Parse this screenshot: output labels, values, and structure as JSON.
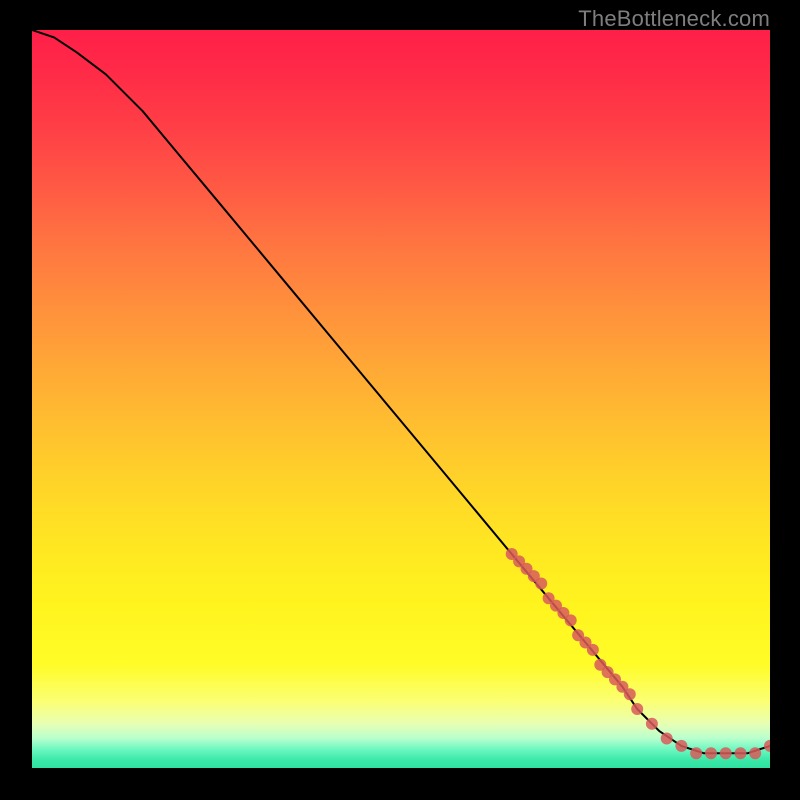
{
  "watermark": {
    "text": "TheBottleneck.com"
  },
  "chart_data": {
    "type": "line",
    "title": "",
    "xlabel": "",
    "ylabel": "",
    "xlim": [
      0,
      100
    ],
    "ylim": [
      0,
      100
    ],
    "grid": false,
    "legend": false,
    "series": [
      {
        "name": "bottleneck-curve",
        "color": "#000000",
        "x": [
          0,
          3,
          6,
          10,
          15,
          20,
          25,
          30,
          35,
          40,
          45,
          50,
          55,
          60,
          65,
          70,
          75,
          80,
          82,
          85,
          88,
          91,
          94,
          97,
          100
        ],
        "values": [
          100,
          99,
          97,
          94,
          89,
          83,
          77,
          71,
          65,
          59,
          53,
          47,
          41,
          35,
          29,
          23,
          17,
          11,
          8,
          5,
          3,
          2,
          2,
          2,
          3
        ]
      }
    ],
    "data_points": {
      "name": "observed-points",
      "color": "#d85a5a",
      "x": [
        65,
        66,
        67,
        68,
        69,
        70,
        71,
        72,
        73,
        74,
        75,
        76,
        77,
        78,
        79,
        80,
        81,
        82,
        84,
        86,
        88,
        90,
        92,
        94,
        96,
        98,
        100
      ],
      "values": [
        29,
        28,
        27,
        26,
        25,
        23,
        22,
        21,
        20,
        18,
        17,
        16,
        14,
        13,
        12,
        11,
        10,
        8,
        6,
        4,
        3,
        2,
        2,
        2,
        2,
        2,
        3
      ]
    },
    "background_gradient": {
      "top": "#ff1f49",
      "mid": "#ffe722",
      "bottom": "#2fe0a0"
    }
  }
}
